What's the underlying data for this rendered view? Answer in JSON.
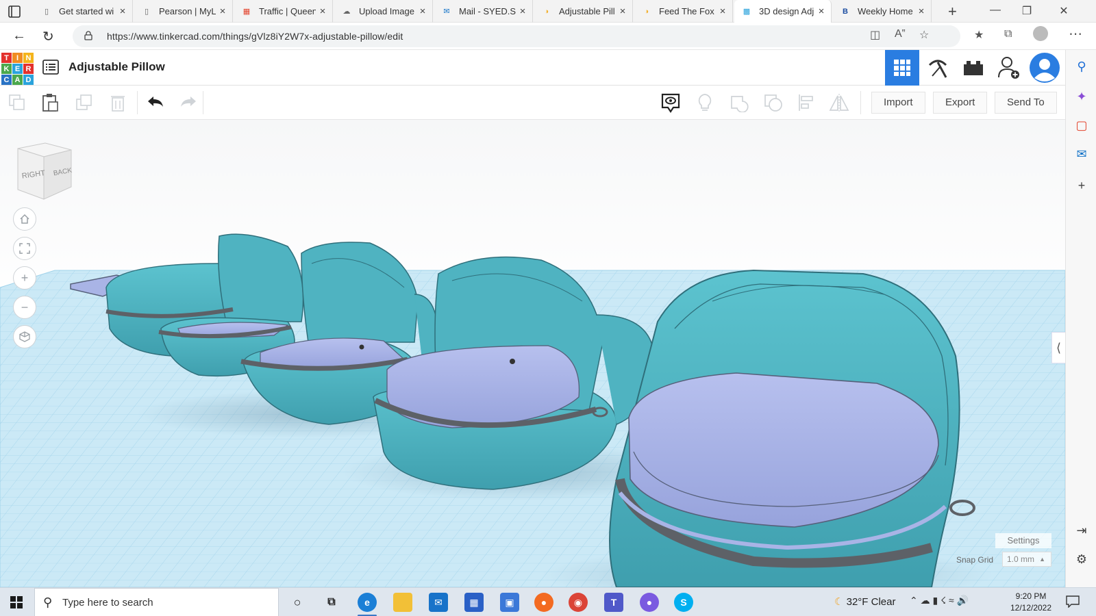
{
  "browser": {
    "tabs": [
      {
        "title": "Get started wi",
        "favicon": "page-icon",
        "active": false
      },
      {
        "title": "Pearson | MyL",
        "favicon": "page-icon",
        "active": false
      },
      {
        "title": "Traffic | Queen",
        "favicon": "microsoft-icon",
        "active": false
      },
      {
        "title": "Upload Image",
        "favicon": "cloud-icon",
        "active": false
      },
      {
        "title": "Mail - SYED.SI",
        "favicon": "outlook-icon",
        "active": false
      },
      {
        "title": "Adjustable Pill",
        "favicon": "instructables-icon",
        "active": false
      },
      {
        "title": "Feed The Fox c",
        "favicon": "instructables-icon",
        "active": false
      },
      {
        "title": "3D design Adj",
        "favicon": "tinkercad-icon",
        "active": true
      },
      {
        "title": "Weekly Home",
        "favicon": "b-icon",
        "active": false
      }
    ],
    "url": "https://www.tinkercad.com/things/gVlz8iY2W7x-adjustable-pillow/edit"
  },
  "tinkercad": {
    "logo_letters": [
      "T",
      "I",
      "N",
      "K",
      "E",
      "R",
      "C",
      "A",
      "D"
    ],
    "design_title": "Adjustable Pillow",
    "header_buttons": [
      "3d-view-grid-icon",
      "codeblocks-pickaxe-icon",
      "bricks-icon",
      "add-user-icon",
      "profile-avatar-icon"
    ],
    "toolbar": {
      "import_label": "Import",
      "export_label": "Export",
      "send_to_label": "Send To"
    },
    "viewcube": {
      "right_label": "RIGHT",
      "back_label": "BACK"
    },
    "settings_label": "Settings",
    "snap_grid_label": "Snap Grid",
    "snap_grid_value": "1.0 mm"
  },
  "taskbar": {
    "search_placeholder": "Type here to search",
    "weather": "32°F  Clear",
    "time": "9:20 PM",
    "date": "12/12/2022"
  },
  "colors": {
    "teal": "#4fb3c1",
    "pad": "#a9b4e6",
    "strap": "#5d6167",
    "accent": "#2a7de1"
  }
}
